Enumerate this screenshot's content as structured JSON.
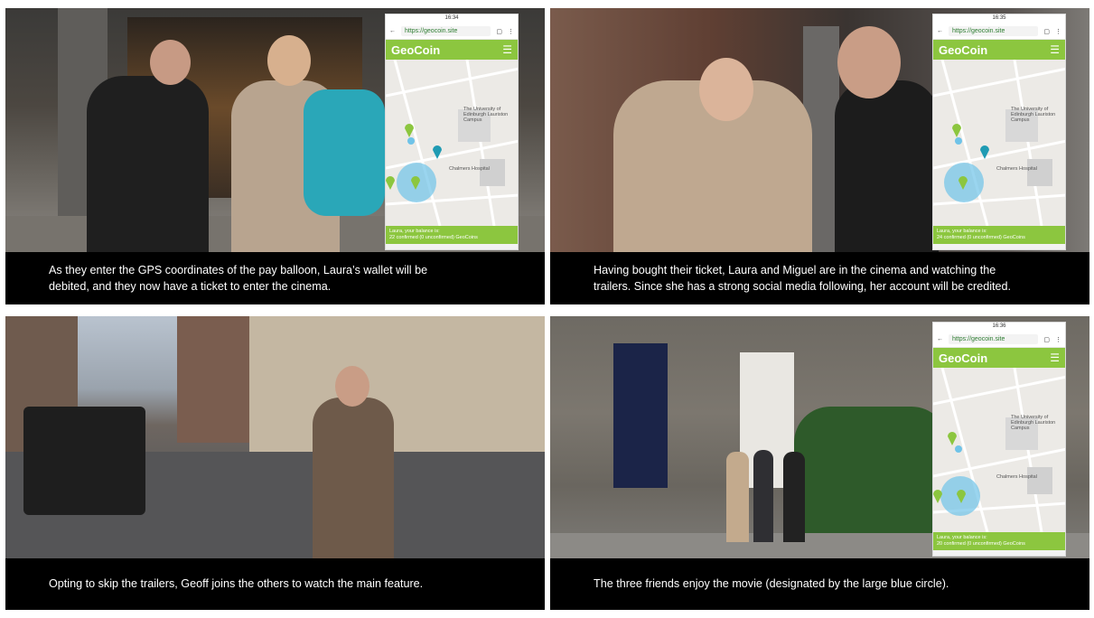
{
  "panels": [
    {
      "caption_line1": "As they enter the GPS coordinates of the pay balloon, Laura’s wallet will be",
      "caption_line2": "debited, and they now have a ticket to enter the cinema."
    },
    {
      "caption_line1": "Having bought their ticket, Laura and Miguel are in the cinema and watching the",
      "caption_line2": "trailers. Since she has a strong social media following, her account will be credited."
    },
    {
      "caption_line1": "Opting to skip the trailers, Geoff joins the others to watch the main feature."
    },
    {
      "caption_line1": "The three friends enjoy the movie (designated by the large blue circle)."
    }
  ],
  "phone": {
    "url": "https://geocoin.site",
    "logo": "GeoCoin",
    "status_time_1": "16:34",
    "status_time_2": "16:35",
    "status_time_3": "16:36",
    "map_label_university": "The University of Edinburgh Lauriston Campus",
    "map_label_hospital": "Chalmers Hospital",
    "balance_line1": "Laura, your balance is:",
    "balance_line2_a": "22 confirmed (0 unconfirmed) GeoCoins",
    "balance_line2_b": "24 confirmed (0 unconfirmed) GeoCoins",
    "balance_line2_c": "20 confirmed (0 unconfirmed) GeoCoins"
  },
  "colors": {
    "brand_green": "#8cc63f",
    "pin_green": "#8cc63f",
    "pin_teal": "#1f9bb3",
    "blue_circle": "#6fc3e8"
  }
}
